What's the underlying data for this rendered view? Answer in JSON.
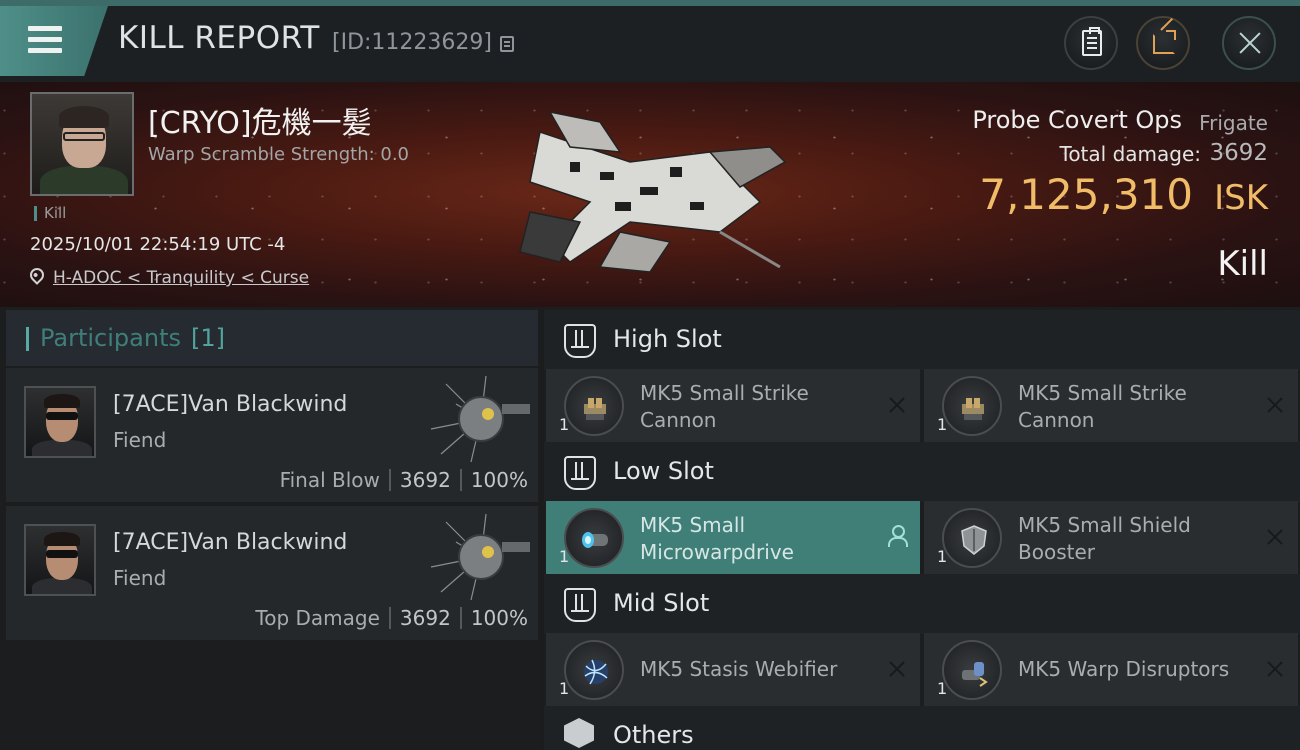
{
  "header": {
    "title": "KILL REPORT",
    "report_id": "[ID:11223629]"
  },
  "victim": {
    "name": "[CRYO]危機一髪",
    "warp_scramble": "Warp Scramble Strength: 0.0",
    "kill_tag": "Kill",
    "datetime": "2025/10/01 22:54:19 UTC -4",
    "location": "H-ADOC < Tranquility < Curse"
  },
  "ship": {
    "name": "Probe Covert Ops",
    "class": "Frigate",
    "damage_label": "Total damage:",
    "damage_value": "3692",
    "isk_value": "7,125,310",
    "isk_unit": "ISK",
    "result": "Kill"
  },
  "participants": {
    "title": "Participants",
    "count": "[1]",
    "items": [
      {
        "name": "[7ACE]Van Blackwind",
        "ship": "Fiend",
        "label": "Final Blow",
        "damage": "3692",
        "percent": "100%"
      },
      {
        "name": "[7ACE]Van Blackwind",
        "ship": "Fiend",
        "label": "Top Damage",
        "damage": "3692",
        "percent": "100%"
      }
    ]
  },
  "slots": {
    "high": {
      "title": "High Slot",
      "modules": [
        {
          "name": "MK5 Small Strike Cannon",
          "qty": "1"
        },
        {
          "name": "MK5 Small Strike Cannon",
          "qty": "1"
        }
      ]
    },
    "low": {
      "title": "Low Slot",
      "modules": [
        {
          "name": "MK5 Small Microwarpdrive",
          "qty": "1"
        },
        {
          "name": "MK5 Small Shield Booster",
          "qty": "1"
        }
      ]
    },
    "mid": {
      "title": "Mid Slot",
      "modules": [
        {
          "name": "MK5 Stasis Webifier",
          "qty": "1"
        },
        {
          "name": "MK5 Warp Disruptors",
          "qty": "1"
        }
      ]
    },
    "others": {
      "title": "Others"
    }
  },
  "colors": {
    "accent": "#4f8f89",
    "isk": "#f0bc68",
    "active_module": "#3f7f78"
  },
  "icons": {
    "menu": "hamburger-icon",
    "copy": "copy-icon",
    "clipboard": "clipboard-icon",
    "share": "share-icon",
    "close": "close-icon",
    "location": "location-pin-icon",
    "slot": "slot-icon",
    "others": "cube-icon",
    "remove": "x-icon",
    "person": "person-icon"
  }
}
